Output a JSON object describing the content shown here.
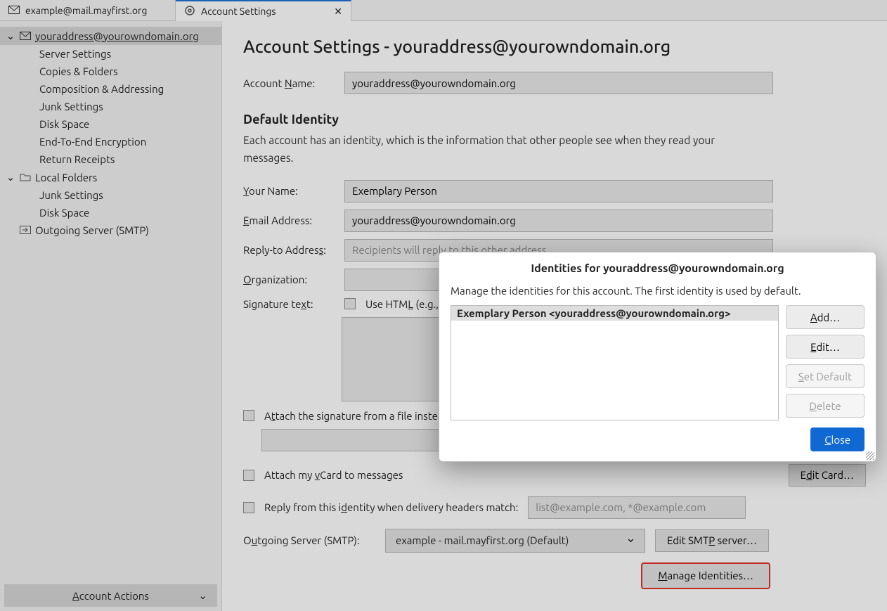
{
  "tabs": {
    "mail_tab": "example@mail.mayfirst.org",
    "settings_tab": "Account Settings"
  },
  "sidebar": {
    "account": "youraddress@yourowndomain.org",
    "items": [
      "Server Settings",
      "Copies & Folders",
      "Composition & Addressing",
      "Junk Settings",
      "Disk Space",
      "End-To-End Encryption",
      "Return Receipts"
    ],
    "local_folders": "Local Folders",
    "local_items": [
      "Junk Settings",
      "Disk Space"
    ],
    "smtp": "Outgoing Server (SMTP)",
    "account_actions": "Account Actions"
  },
  "page": {
    "title_prefix": "Account Settings - ",
    "title_addr": "youraddress@yourowndomain.org",
    "account_name_label": "Account Name:",
    "account_name_value": "youraddress@yourowndomain.org",
    "identity_header": "Default Identity",
    "identity_desc": "Each account has an identity, which is the information that other people see when they read your messages.",
    "your_name_label": "Your Name:",
    "your_name_value": "Exemplary Person",
    "email_label": "Email Address:",
    "email_value": "youraddress@yourowndomain.org",
    "reply_label": "Reply-to Address:",
    "reply_placeholder": "Recipients will reply to this other address",
    "org_label": "Organization:",
    "sig_label": "Signature text:",
    "use_html_label": "Use HTML (e.g., <b>bold</b>)",
    "attach_sig_label": "Attach the signature from a file instead (text, HTML, or image):",
    "attach_vcard_label": "Attach my vCard to messages",
    "edit_card": "Edit Card…",
    "reply_identity_label": "Reply from this identity when delivery headers match:",
    "reply_identity_placeholder": "list@example.com, *@example.com",
    "smtp_label": "Outgoing Server (SMTP):",
    "smtp_value": "example - mail.mayfirst.org (Default)",
    "edit_smtp": "Edit SMTP server…",
    "manage_identities": "Manage Identities…"
  },
  "dialog": {
    "title": "Identities for youraddress@yourowndomain.org",
    "desc": "Manage the identities for this account. The first identity is used by default.",
    "list_item": "Exemplary Person <youraddress@yourowndomain.org>",
    "add": "Add…",
    "edit": "Edit…",
    "set_default": "Set Default",
    "delete": "Delete",
    "close": "Close"
  }
}
